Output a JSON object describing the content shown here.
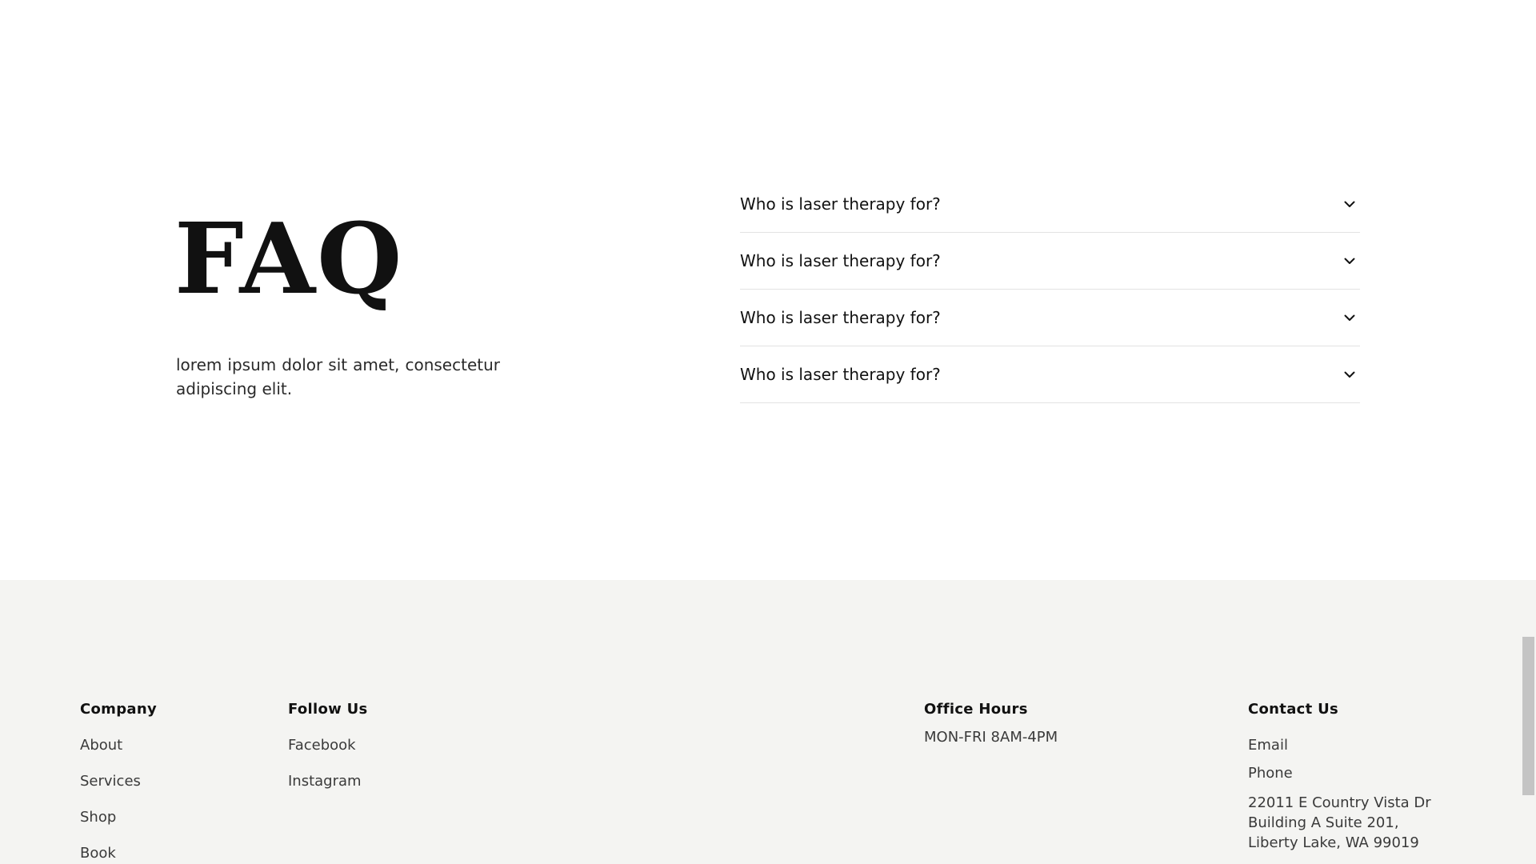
{
  "faq": {
    "title": "FAQ",
    "description": "lorem ipsum dolor sit amet, consectetur adipiscing elit.",
    "items": [
      {
        "question": "Who is laser therapy for?"
      },
      {
        "question": "Who is laser therapy for?"
      },
      {
        "question": "Who is laser therapy for?"
      },
      {
        "question": "Who is laser therapy for?"
      }
    ],
    "chevron_icon": "chevron-down-icon"
  },
  "footer": {
    "company": {
      "heading": "Company",
      "links": [
        "About",
        "Services",
        "Shop",
        "Book"
      ]
    },
    "follow": {
      "heading": "Follow Us",
      "links": [
        "Facebook",
        "Instagram"
      ]
    },
    "hours": {
      "heading": "Office Hours",
      "text": "MON-FRI 8AM-4PM"
    },
    "contact": {
      "heading": "Contact Us",
      "links": [
        "Email",
        "Phone"
      ],
      "address": [
        "22011 E Country Vista Dr",
        "Building A Suite 201,",
        "Liberty Lake, WA 99019"
      ]
    },
    "background_color": "#f4f4f2"
  }
}
